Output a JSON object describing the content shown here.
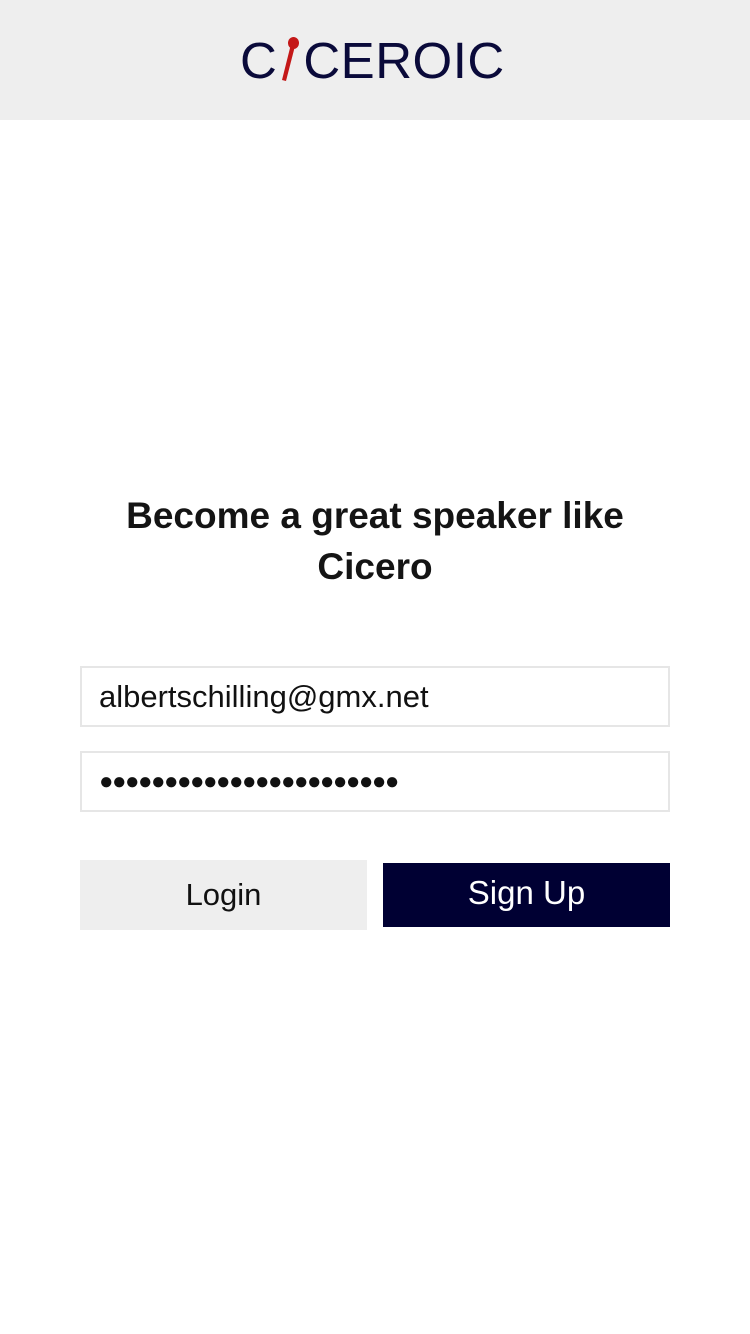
{
  "header": {
    "logo": {
      "text_before": "C",
      "text_after": "CEROIC",
      "icon": "microphone-icon",
      "text_color": "#0a0a3a",
      "icon_color": "#c41818"
    }
  },
  "main": {
    "headline_line1": "Become a great speaker like",
    "headline_line2": "Cicero",
    "email_value": "albertschilling@gmx.net",
    "password_value": "●●●●●●●●●●●●●●●●●●●●●●●",
    "login_label": "Login",
    "signup_label": "Sign Up"
  },
  "colors": {
    "header_bg": "#eeeeee",
    "primary_button": "#000033",
    "secondary_button": "#eeeeee"
  }
}
